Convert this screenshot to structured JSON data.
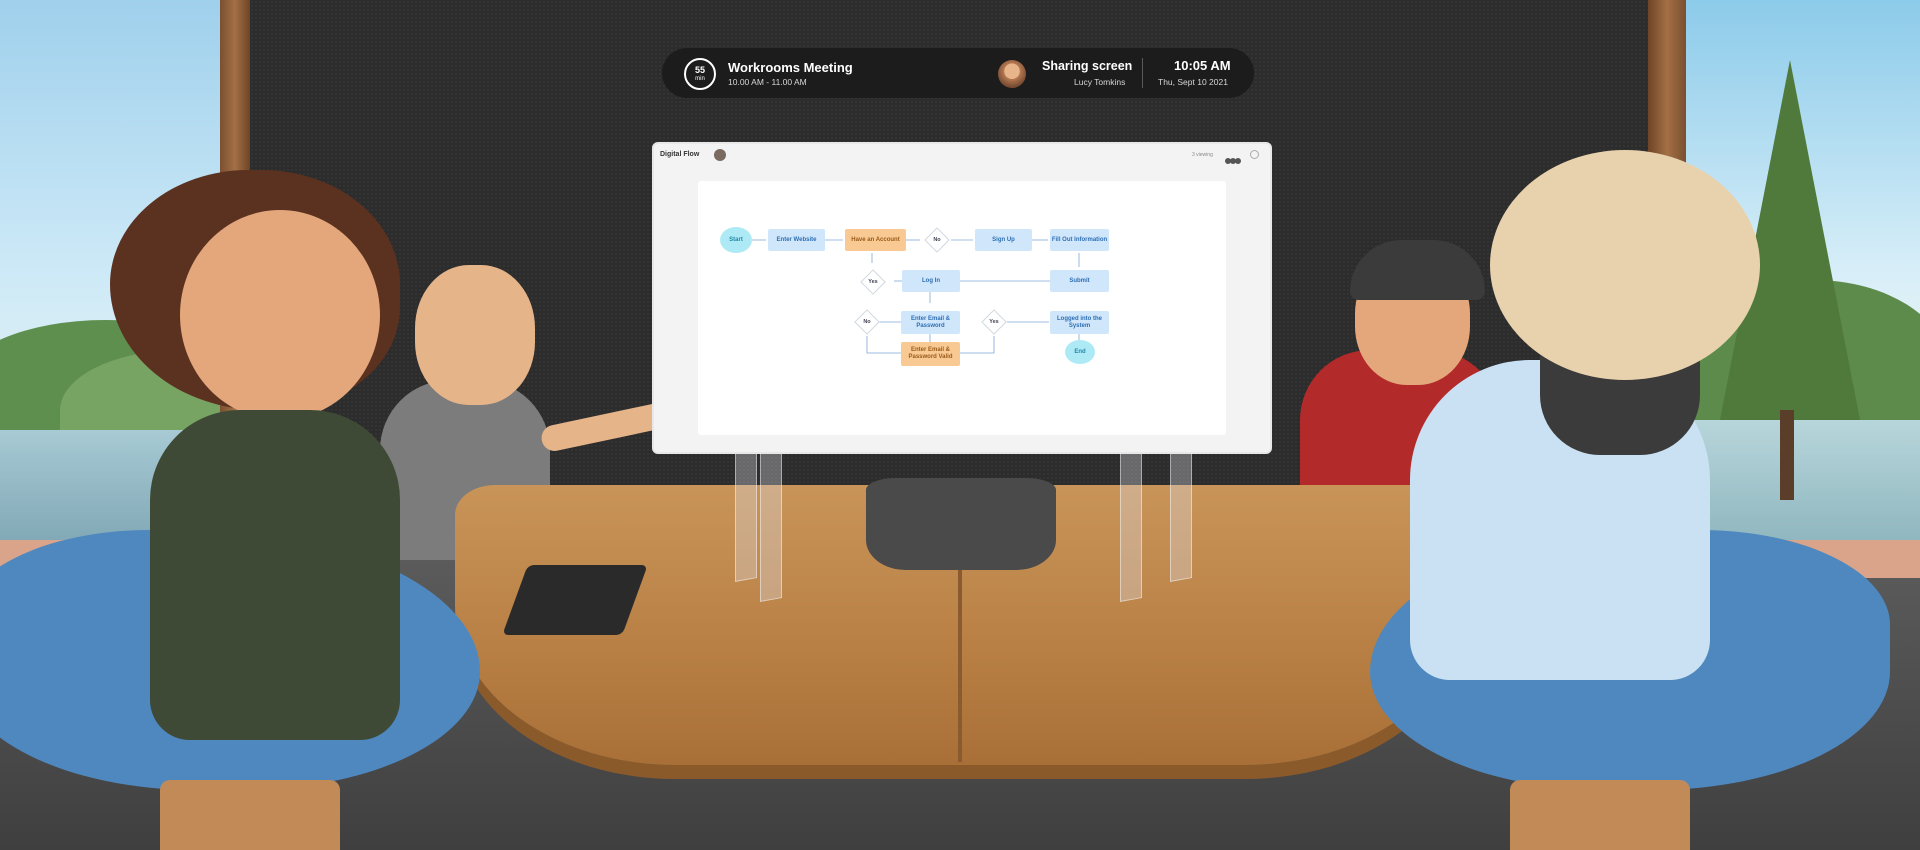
{
  "meeting_bar": {
    "timer_value": "55",
    "timer_unit": "min",
    "title": "Workrooms Meeting",
    "time_range": "10.00 AM - 11.00 AM",
    "sharing_label": "Sharing screen",
    "presenter_name": "Lucy Tomkins",
    "current_time": "10:05 AM",
    "current_date": "Thu, Sept 10 2021"
  },
  "shared_screen": {
    "doc_title": "Digital Flow",
    "viewing_text": "3 viewing",
    "flowchart": {
      "start": "Start",
      "enter_website": "Enter Website",
      "have_account": "Have an Account",
      "no_1": "No",
      "sign_up": "Sign Up",
      "fill_info": "Fill Out Information",
      "yes_1": "Yes",
      "log_in": "Log In",
      "submit": "Submit",
      "no_2": "No",
      "enter_email": "Enter Email & Password",
      "yes_2": "Yes",
      "logged_in": "Logged into the System",
      "email_valid": "Enter Email & Password Valid",
      "end": "End"
    }
  },
  "colors": {
    "bar_bg": "#1c1c1c",
    "node_blue": "#cfe6fb",
    "node_orange": "#f8c993",
    "node_round": "#aeeaf5",
    "table_wood": "#c99458",
    "chair_blue": "#4f88bf"
  }
}
